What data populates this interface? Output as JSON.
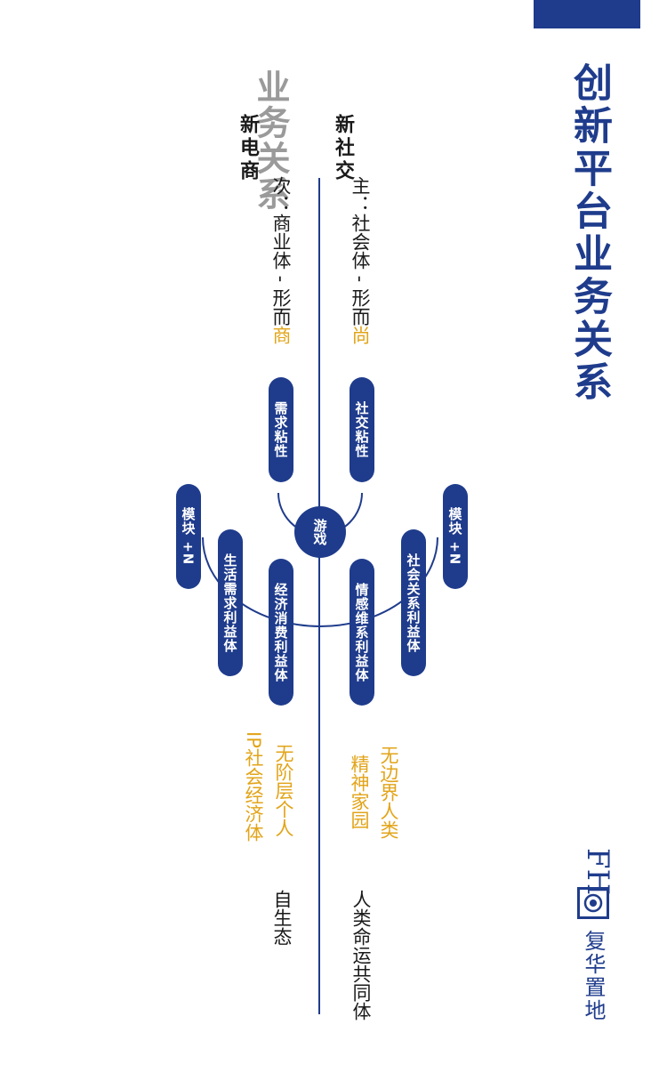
{
  "title": "创新平台业务关系",
  "section_label": "业务关系",
  "categories": [
    "新社交",
    "新电商"
  ],
  "main_line": {
    "prefix": "主：社会体 - 形而",
    "highlight": "尚"
  },
  "sub_line": {
    "prefix": "次：商业体 - 形而",
    "highlight": "商"
  },
  "center": "游戏",
  "pills": {
    "social_stickiness": "社交粘性",
    "demand_stickiness": "需求粘性",
    "module_top": "模块 +N",
    "social_relation": "社会关系利益体",
    "emotional_bond": "情感维系利益体",
    "economic_consumption": "经济消费利益体",
    "life_demand": "生活需求利益体",
    "module_bottom": "模块 +N"
  },
  "outcomes": {
    "borderless_human": "无边界人类",
    "spiritual_home": "精神家园",
    "classless_individual": "无阶层个人",
    "ip_economy": "IP社会经济体",
    "community_destiny": "人类命运共同体",
    "self_ecology": "自生态"
  },
  "logo": {
    "letters": "FH",
    "name": "复华置地"
  },
  "colors": {
    "brand_blue": "#1f3c8c",
    "accent_gold": "#e2a419",
    "section_gray": "#9a9a9a"
  }
}
